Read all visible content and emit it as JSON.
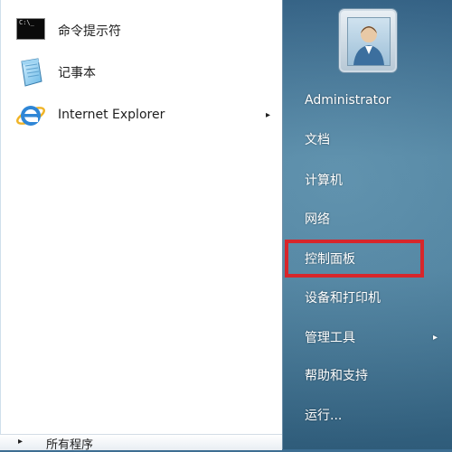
{
  "left_pane": {
    "pinned_items": [
      {
        "label": "命令提示符",
        "icon": "command-prompt-icon"
      },
      {
        "label": "记事本",
        "icon": "notepad-icon"
      },
      {
        "label": "Internet Explorer",
        "icon": "internet-explorer-icon",
        "submenu_arrow": "▸"
      }
    ],
    "cmd_icon_text": "C:\\_",
    "all_programs": {
      "label": "所有程序",
      "arrow": "▸"
    }
  },
  "right_pane": {
    "user_picture_icon": "user-avatar-icon",
    "items": [
      {
        "label": "Administrator"
      },
      {
        "label": "文档"
      },
      {
        "label": "计算机"
      },
      {
        "label": "网络"
      },
      {
        "label": "控制面板",
        "highlighted": true
      },
      {
        "label": "设备和打印机"
      },
      {
        "label": "管理工具",
        "submenu_arrow": "▸"
      },
      {
        "label": "帮助和支持"
      },
      {
        "label": "运行..."
      }
    ]
  },
  "colors": {
    "highlight": "#d7262b",
    "right_pane": "#3d6e92",
    "left_pane": "#ffffff"
  }
}
